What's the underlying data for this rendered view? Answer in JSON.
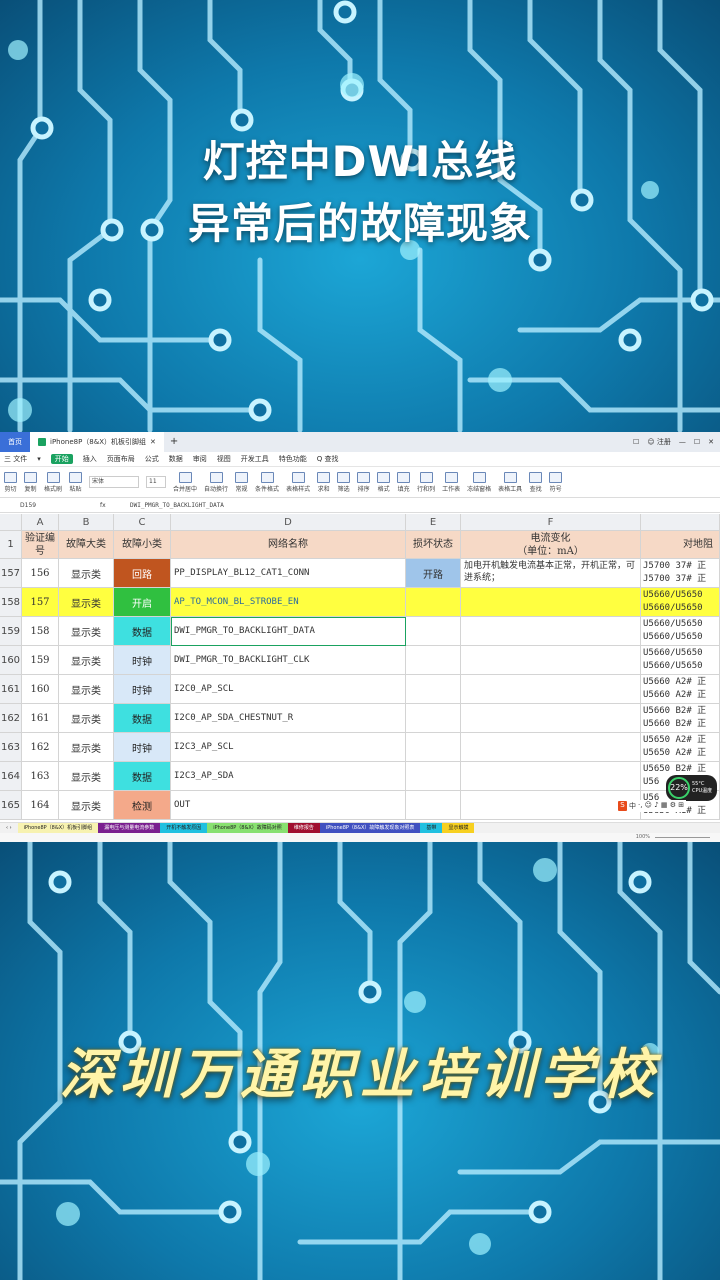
{
  "overlay": {
    "title_line1": "灯控中DWI总线",
    "title_line2": "异常后的故障现象",
    "school_name": "深圳万通职业培训学校"
  },
  "app": {
    "tab_home": "首页",
    "tab_doc": "iPhone8P（8&X）机板引脚组",
    "tab_plus": "+",
    "right_items": [
      "☐",
      "☺ 注册",
      "—",
      "☐",
      "✕"
    ],
    "menu": [
      "三 文件",
      "▾",
      "开始",
      "插入",
      "页面布局",
      "公式",
      "数据",
      "审阅",
      "视图",
      "开发工具",
      "特色功能",
      "Q 查找"
    ],
    "menu_active": "开始",
    "ribbon": [
      "剪切",
      "复制",
      "格式刷",
      "粘贴",
      "宋体",
      "11",
      "合并居中",
      "自动换行",
      "常规",
      "条件格式",
      "表格样式",
      "求和",
      "筛选",
      "排序",
      "格式",
      "填充",
      "行和列",
      "工作表",
      "冻结窗格",
      "表格工具",
      "查找",
      "符号"
    ],
    "font_name": "宋体",
    "font_size": "11",
    "cell_ref": "D159",
    "fx": "fx",
    "formula_value": "DWI_PMGR_TO_BACKLIGHT_DATA"
  },
  "columns": [
    "A",
    "B",
    "C",
    "D",
    "E",
    "F"
  ],
  "header_row": {
    "row": "1",
    "a": "验证编号",
    "b": "故障大类",
    "c": "故障小类",
    "d": "网络名称",
    "e": "损坏状态",
    "f": "电流变化\n（单位：mA）",
    "g": "对地阻"
  },
  "rows": [
    {
      "row": "157",
      "a": "156",
      "b": "显示类",
      "c": "回路",
      "c_color": "#c0551f",
      "c_text": "#ffffff",
      "d": "PP_DISPLAY_BL12_CAT1_CONN",
      "e": "开路",
      "f": "加电开机触发电流基本正常，开机正常，可进系统；",
      "g": [
        "J5700 37# 正",
        "J5700 37# 正"
      ],
      "yellow": false
    },
    {
      "row": "158",
      "a": "157",
      "b": "显示类",
      "c": "开启",
      "c_color": "#30c040",
      "c_text": "#ffffff",
      "d": "AP_TO_MCON_BL_STROBE_EN",
      "e": "",
      "f": "",
      "g": [
        "U5660/U5650",
        "U5660/U5650"
      ],
      "yellow": true
    },
    {
      "row": "159",
      "a": "158",
      "b": "显示类",
      "c": "数据",
      "c_color": "#3ee0e0",
      "c_text": "#222222",
      "d": "DWI_PMGR_TO_BACKLIGHT_DATA",
      "e": "",
      "f": "",
      "g": [
        "U5660/U5650",
        "U5660/U5650"
      ],
      "yellow": false
    },
    {
      "row": "160",
      "a": "159",
      "b": "显示类",
      "c": "时钟",
      "c_color": "#d8e8f8",
      "c_text": "#222222",
      "d": "DWI_PMGR_TO_BACKLIGHT_CLK",
      "e": "",
      "f": "",
      "g": [
        "U5660/U5650",
        "U5660/U5650"
      ],
      "yellow": false
    },
    {
      "row": "161",
      "a": "160",
      "b": "显示类",
      "c": "时钟",
      "c_color": "#d8e8f8",
      "c_text": "#222222",
      "d": "I2C0_AP_SCL",
      "e": "",
      "f": "",
      "g": [
        "U5660 A2# 正",
        "U5660 A2# 正"
      ],
      "yellow": false
    },
    {
      "row": "162",
      "a": "161",
      "b": "显示类",
      "c": "数据",
      "c_color": "#3ee0e0",
      "c_text": "#222222",
      "d": "I2C0_AP_SDA_CHESTNUT_R",
      "e": "",
      "f": "",
      "g": [
        "U5660 B2# 正",
        "U5660 B2# 正"
      ],
      "yellow": false
    },
    {
      "row": "163",
      "a": "162",
      "b": "显示类",
      "c": "时钟",
      "c_color": "#d8e8f8",
      "c_text": "#222222",
      "d": "I2C3_AP_SCL",
      "e": "",
      "f": "",
      "g": [
        "U5650 A2# 正",
        "U5650 A2# 正"
      ],
      "yellow": false
    },
    {
      "row": "164",
      "a": "163",
      "b": "显示类",
      "c": "数据",
      "c_color": "#3ee0e0",
      "c_text": "#222222",
      "d": "I2C3_AP_SDA",
      "e": "",
      "f": "",
      "g": [
        "U5650 B2# 正",
        "U56"
      ],
      "yellow": false
    },
    {
      "row": "165",
      "a": "164",
      "b": "显示类",
      "c": "检测",
      "c_color": "#f4a98a",
      "c_text": "#222222",
      "d": "OUT",
      "e": "",
      "f": "",
      "g": [
        "U56",
        "U5650 A1# 正"
      ],
      "yellow": false
    }
  ],
  "sheets": [
    {
      "label": "iPhone8P（8&X）机板引脚组",
      "color": "#f7f2b0"
    },
    {
      "label": "漏电压与测量电流参数",
      "color": "#7a1f8f"
    },
    {
      "label": "开机不触发原因",
      "color": "#20c0e0"
    },
    {
      "label": "iPhone8P（8&X）故障码对照",
      "color": "#88e070"
    },
    {
      "label": "维修报告",
      "color": "#a01030"
    },
    {
      "label": "iPhone8P（8&X）故障触发现象对照表",
      "color": "#4050c0"
    },
    {
      "label": "基带",
      "color": "#20c0e0"
    },
    {
      "label": "显示触摸",
      "color": "#f7d020"
    }
  ],
  "status": {
    "zoom": "100%"
  },
  "badge": {
    "percent": "22%",
    "temp": "55°C",
    "cpu": "CPU温度"
  },
  "ime": {
    "logo": "S",
    "lang": "中",
    "icons": "·, ☺ ♪ ▦ ⚙ ⊞"
  }
}
